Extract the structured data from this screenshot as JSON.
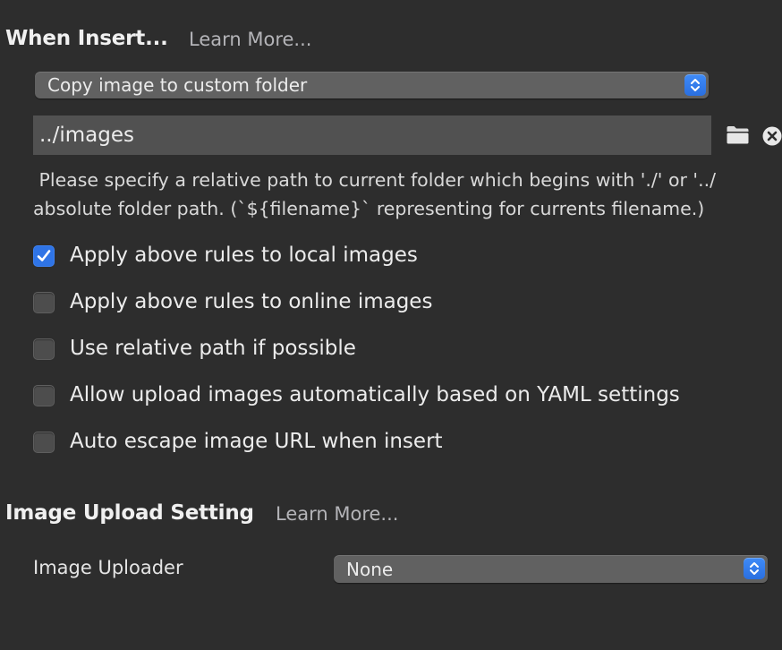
{
  "insert_section": {
    "title": "When Insert...",
    "learn_more": "Learn More...",
    "action_select": {
      "selected": "Copy image to custom folder"
    },
    "folder_path": {
      "value": "../images"
    },
    "help_text": {
      "line1": " Please specify a relative path to current folder which begins with './' or '../",
      "line2": "absolute folder path. (`${filename}` representing for currents filename.)"
    },
    "options": [
      {
        "label": "Apply above rules to local images",
        "checked": true
      },
      {
        "label": "Apply above rules to online images",
        "checked": false
      },
      {
        "label": "Use relative path if possible",
        "checked": false
      },
      {
        "label": "Allow upload images automatically based on YAML settings",
        "checked": false
      },
      {
        "label": "Auto escape image URL when insert",
        "checked": false
      }
    ]
  },
  "upload_section": {
    "title": "Image Upload Setting",
    "learn_more": "Learn More...",
    "uploader_label": "Image Uploader",
    "uploader_select": {
      "selected": "None"
    }
  },
  "colors": {
    "background": "#2d2d2d",
    "accent": "#2f74e6",
    "popup": "#616161",
    "field": "#515151"
  }
}
